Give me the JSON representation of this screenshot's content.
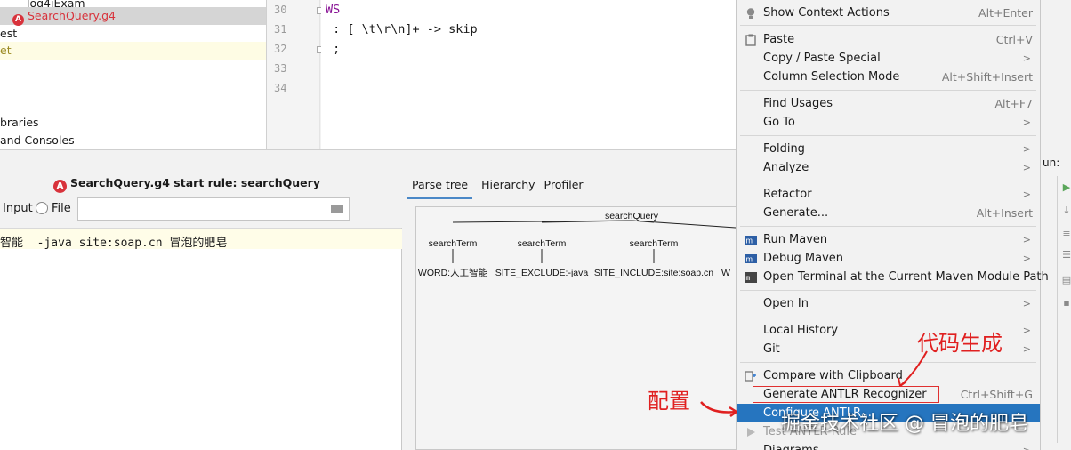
{
  "project_tree": {
    "items": [
      {
        "label": "log4jExam"
      },
      {
        "label": "SearchQuery.g4"
      },
      {
        "label": "est"
      },
      {
        "label": "et"
      },
      {
        "label": "braries"
      },
      {
        "label": "and Consoles"
      }
    ]
  },
  "editor": {
    "line_numbers": [
      "30",
      "31",
      "32",
      "33",
      "34"
    ],
    "lines": [
      "WS",
      " : [ \\t\\r\\n]+ -> skip",
      " ;",
      "",
      ""
    ]
  },
  "antlr_preview": {
    "title": "SearchQuery.g4 start rule: searchQuery",
    "input_option": "Input",
    "file_option": "File",
    "file_path": "",
    "input_text": "智能  -java site:soap.cn 冒泡的肥皂"
  },
  "parse_tree_panel": {
    "tabs": [
      "Parse tree",
      "Hierarchy",
      "Profiler"
    ],
    "root": "searchQuery",
    "children": [
      "searchTerm",
      "searchTerm",
      "searchTerm"
    ],
    "leaves": [
      "WORD:人工智能",
      "SITE_EXCLUDE:-java",
      "SITE_INCLUDE:site:soap.cn",
      "W"
    ]
  },
  "context_menu": {
    "items": [
      {
        "label": "Show Context Actions",
        "shortcut": "Alt+Enter",
        "icon": "bulb-icon"
      },
      {
        "label": "Paste",
        "shortcut": "Ctrl+V",
        "icon": "clipboard-icon"
      },
      {
        "label": "Copy / Paste Special",
        "submenu": true
      },
      {
        "label": "Column Selection Mode",
        "shortcut": "Alt+Shift+Insert"
      },
      {
        "label": "Find Usages",
        "shortcut": "Alt+F7"
      },
      {
        "label": "Go To",
        "submenu": true
      },
      {
        "label": "Folding",
        "submenu": true
      },
      {
        "label": "Analyze",
        "submenu": true
      },
      {
        "label": "Refactor",
        "submenu": true
      },
      {
        "label": "Generate...",
        "shortcut": "Alt+Insert"
      },
      {
        "label": "Run Maven",
        "submenu": true,
        "icon": "maven-icon"
      },
      {
        "label": "Debug Maven",
        "submenu": true,
        "icon": "maven-icon"
      },
      {
        "label": "Open Terminal at the Current Maven Module Path",
        "icon": "terminal-icon"
      },
      {
        "label": "Open In",
        "submenu": true
      },
      {
        "label": "Local History",
        "submenu": true
      },
      {
        "label": "Git",
        "submenu": true
      },
      {
        "label": "Compare with Clipboard",
        "icon": "compare-icon"
      },
      {
        "label": "Generate ANTLR Recognizer",
        "shortcut": "Ctrl+Shift+G"
      },
      {
        "label": "Configure ANTLR...",
        "active": true
      },
      {
        "label": "Test ANTLR Rule",
        "disabled": true
      },
      {
        "label": "Diagrams",
        "submenu": true
      }
    ]
  },
  "run_panel": {
    "label": "un:"
  },
  "annotations": {
    "code_gen": "代码生成",
    "config": "配置",
    "watermark": "掘金技术社区 @ 冒泡的肥皂"
  },
  "colors": {
    "accent": "#2675bf",
    "annotation": "#e02020",
    "antlr": "#d8323b"
  }
}
